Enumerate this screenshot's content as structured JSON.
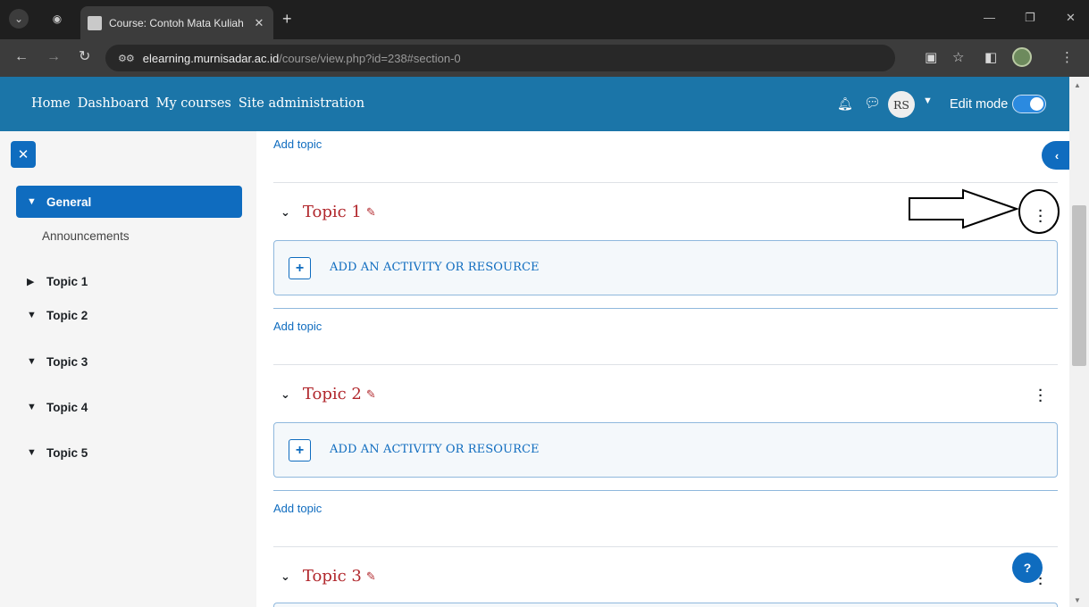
{
  "browser": {
    "tab_title": "Course: Contoh Mata Kuliah",
    "url_host": "elearning.murnisadar.ac.id",
    "url_path": "/course/view.php?id=238#section-0"
  },
  "navbar": {
    "links": [
      "Home",
      "Dashboard",
      "My courses",
      "Site administration"
    ],
    "avatar_initials": "RS",
    "edit_mode_label": "Edit mode",
    "edit_mode_on": true
  },
  "drawer": {
    "general_label": "General",
    "announcements_label": "Announcements",
    "topics": [
      "Topic 1",
      "Topic 2",
      "Topic 3",
      "Topic 4",
      "Topic 5"
    ]
  },
  "main": {
    "add_topic_label": "Add topic",
    "add_activity_label": "ADD AN ACTIVITY OR RESOURCE",
    "sections": [
      "Topic 1",
      "Topic 2",
      "Topic 3"
    ]
  },
  "colors": {
    "navbar": "#1b75a8",
    "primary": "#0f6cbf",
    "section_title": "#b1272c"
  }
}
